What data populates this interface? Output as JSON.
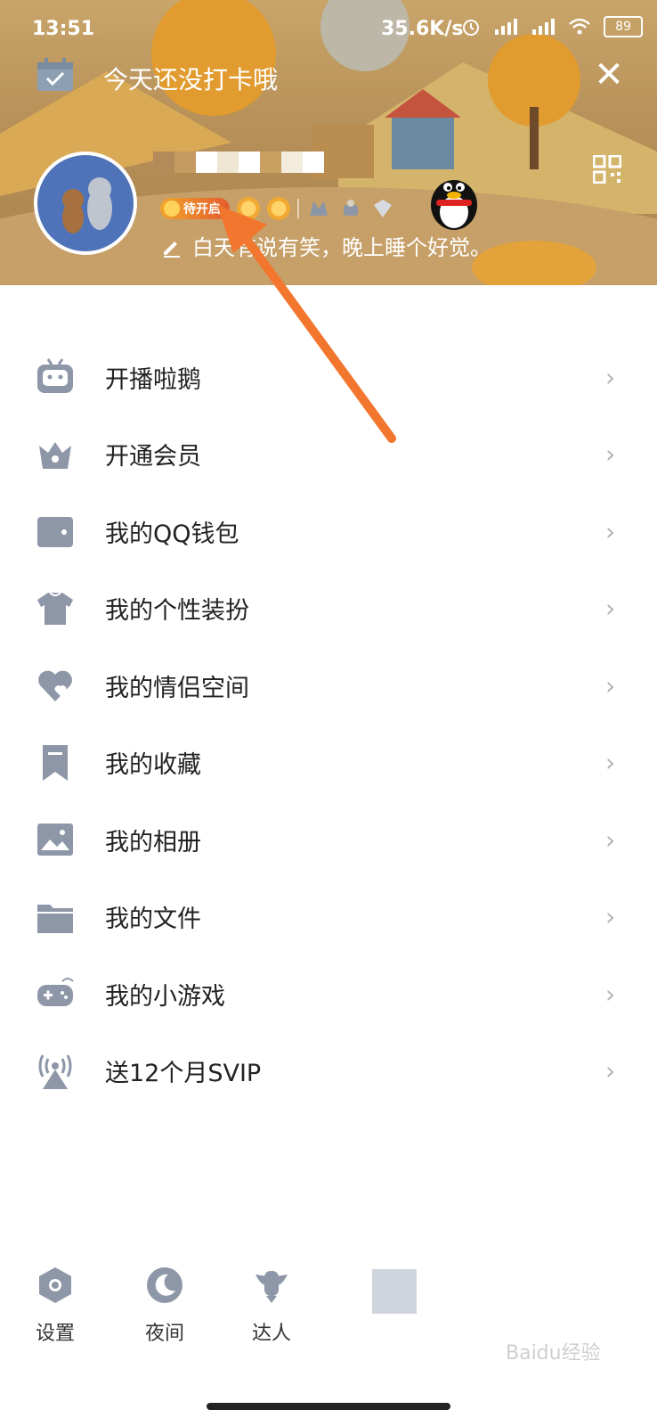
{
  "status_bar": {
    "time": "13:51",
    "speed": "35.6K/s",
    "battery": "89"
  },
  "header": {
    "checkin_text": "今天还没打卡哦",
    "close_glyph": "✕",
    "badge_label": "待开启",
    "signature": "白天有说有笑，晚上睡个好觉。"
  },
  "menu": {
    "items": [
      {
        "label": "开播啦鹅",
        "icon": "tv-robot-icon",
        "chevron": "›"
      },
      {
        "label": "开通会员",
        "icon": "crown-icon",
        "chevron": "›"
      },
      {
        "label": "我的QQ钱包",
        "icon": "wallet-icon",
        "chevron": "›"
      },
      {
        "label": "我的个性装扮",
        "icon": "tshirt-icon",
        "chevron": "›"
      },
      {
        "label": "我的情侣空间",
        "icon": "heart-icon",
        "chevron": "›"
      },
      {
        "label": "我的收藏",
        "icon": "bookmark-icon",
        "chevron": "›"
      },
      {
        "label": "我的相册",
        "icon": "picture-icon",
        "chevron": "›"
      },
      {
        "label": "我的文件",
        "icon": "folder-icon",
        "chevron": "›"
      },
      {
        "label": "我的小游戏",
        "icon": "gamepad-icon",
        "chevron": "›"
      },
      {
        "label": "送12个月SVIP",
        "icon": "broadcast-icon",
        "chevron": "›"
      }
    ]
  },
  "bottom_bar": {
    "settings_label": "设置",
    "night_label": "夜间",
    "expert_label": "达人"
  },
  "watermark": "Baidu经验",
  "colors": {
    "icon_gray": "#8e97a8",
    "arrow": "#f2762e",
    "avatar_bg": "#4f73b8"
  }
}
